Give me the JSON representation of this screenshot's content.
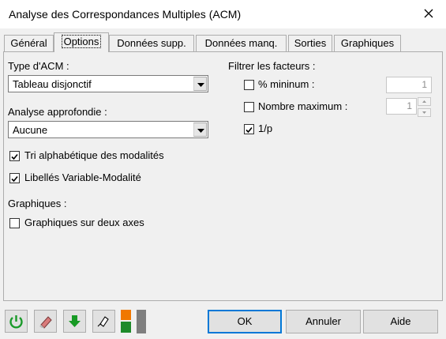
{
  "window": {
    "title": "Analyse des Correspondances Multiples (ACM)"
  },
  "tabs": [
    "Général",
    "Options",
    "Données supp.",
    "Données manq.",
    "Sorties",
    "Graphiques"
  ],
  "options": {
    "type_acm": {
      "label": "Type d'ACM :",
      "value": "Tableau disjonctif"
    },
    "analyse": {
      "label": "Analyse approfondie :",
      "value": "Aucune"
    },
    "tri": {
      "label": "Tri alphabétique des modalités",
      "checked": true
    },
    "libelles": {
      "label": "Libellés Variable-Modalité",
      "checked": true
    },
    "graphiques_heading": "Graphiques :",
    "graphiques_deux_axes": {
      "label": "Graphiques sur deux axes",
      "checked": false
    },
    "filtrer": {
      "heading": "Filtrer les facteurs :",
      "minimum": {
        "label": "% mininum :",
        "value": "1",
        "checked": false
      },
      "maximum": {
        "label": "Nombre maximum :",
        "value": "1",
        "checked": false
      },
      "inv_p": {
        "label": "1/p",
        "checked": true
      }
    }
  },
  "buttons": {
    "ok": "OK",
    "cancel": "Annuler",
    "help": "Aide"
  },
  "icons": {
    "reset": "reset-icon",
    "eraser": "eraser-icon",
    "down": "down-arrow-icon",
    "selection": "mouse-selection-icon",
    "color": "color-swatch-icon"
  }
}
